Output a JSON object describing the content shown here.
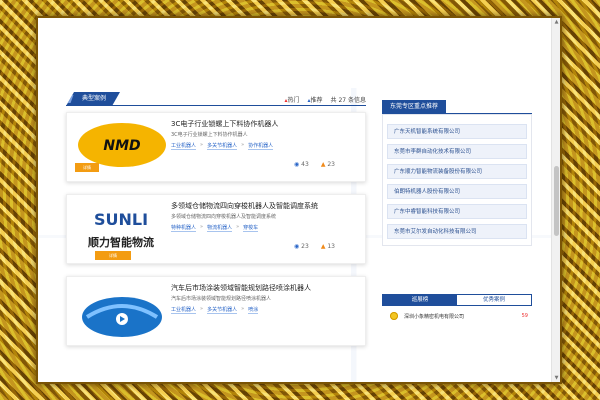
{
  "left": {
    "section_title": "典型案例",
    "filter_hot": "热门",
    "filter_recommend": "推荐",
    "count_text": "共 27 条信息"
  },
  "cards": [
    {
      "title": "3C电子行业锁螺上下料协作机器人",
      "desc": "3C电子行业锁螺上下料协作机器人",
      "tags": [
        "工业机器人",
        "多关节机器人",
        "协作机器人"
      ],
      "views": "43",
      "likes": "23",
      "brand": "NMD",
      "button": "详情"
    },
    {
      "title": "多领域仓储物流四向穿梭机器人及智能调度系统",
      "desc": "多领域仓储物流四向穿梭机器人及智能调度系统",
      "tags": [
        "特种机器人",
        "物流机器人",
        "穿梭车"
      ],
      "views": "23",
      "likes": "13",
      "brand": "SUNLI",
      "brand_cn": "顺力智能物流",
      "button": "详情"
    },
    {
      "title": "汽车后市场涂装领域智能规划路径喷涂机器人",
      "desc": "汽车后市场涂装领域智能规划路径喷涂机器人",
      "tags": [
        "工业机器人",
        "多关节机器人",
        "喷涂"
      ],
      "views": "",
      "likes": ""
    }
  ],
  "right": {
    "title": "东莞专区重点推荐",
    "companies": [
      "广东天机智能系统有限公司",
      "东莞市李群自动化技术有限公司",
      "广东顺力智能物流装备股份有限公司",
      "伯朗特机器人股份有限公司",
      "广东中睿智能科技有限公司",
      "东莞市艾尔发自动化科技有限公司"
    ],
    "tab_active": "巡展榜",
    "tab_inactive": "优秀案例",
    "top_entry": "深圳小象精密机电有限公司",
    "top_score": "59"
  },
  "colors": {
    "brand_blue": "#1f4e9b",
    "accent_orange": "#f39c12",
    "frame_gold": "#c9a227"
  }
}
